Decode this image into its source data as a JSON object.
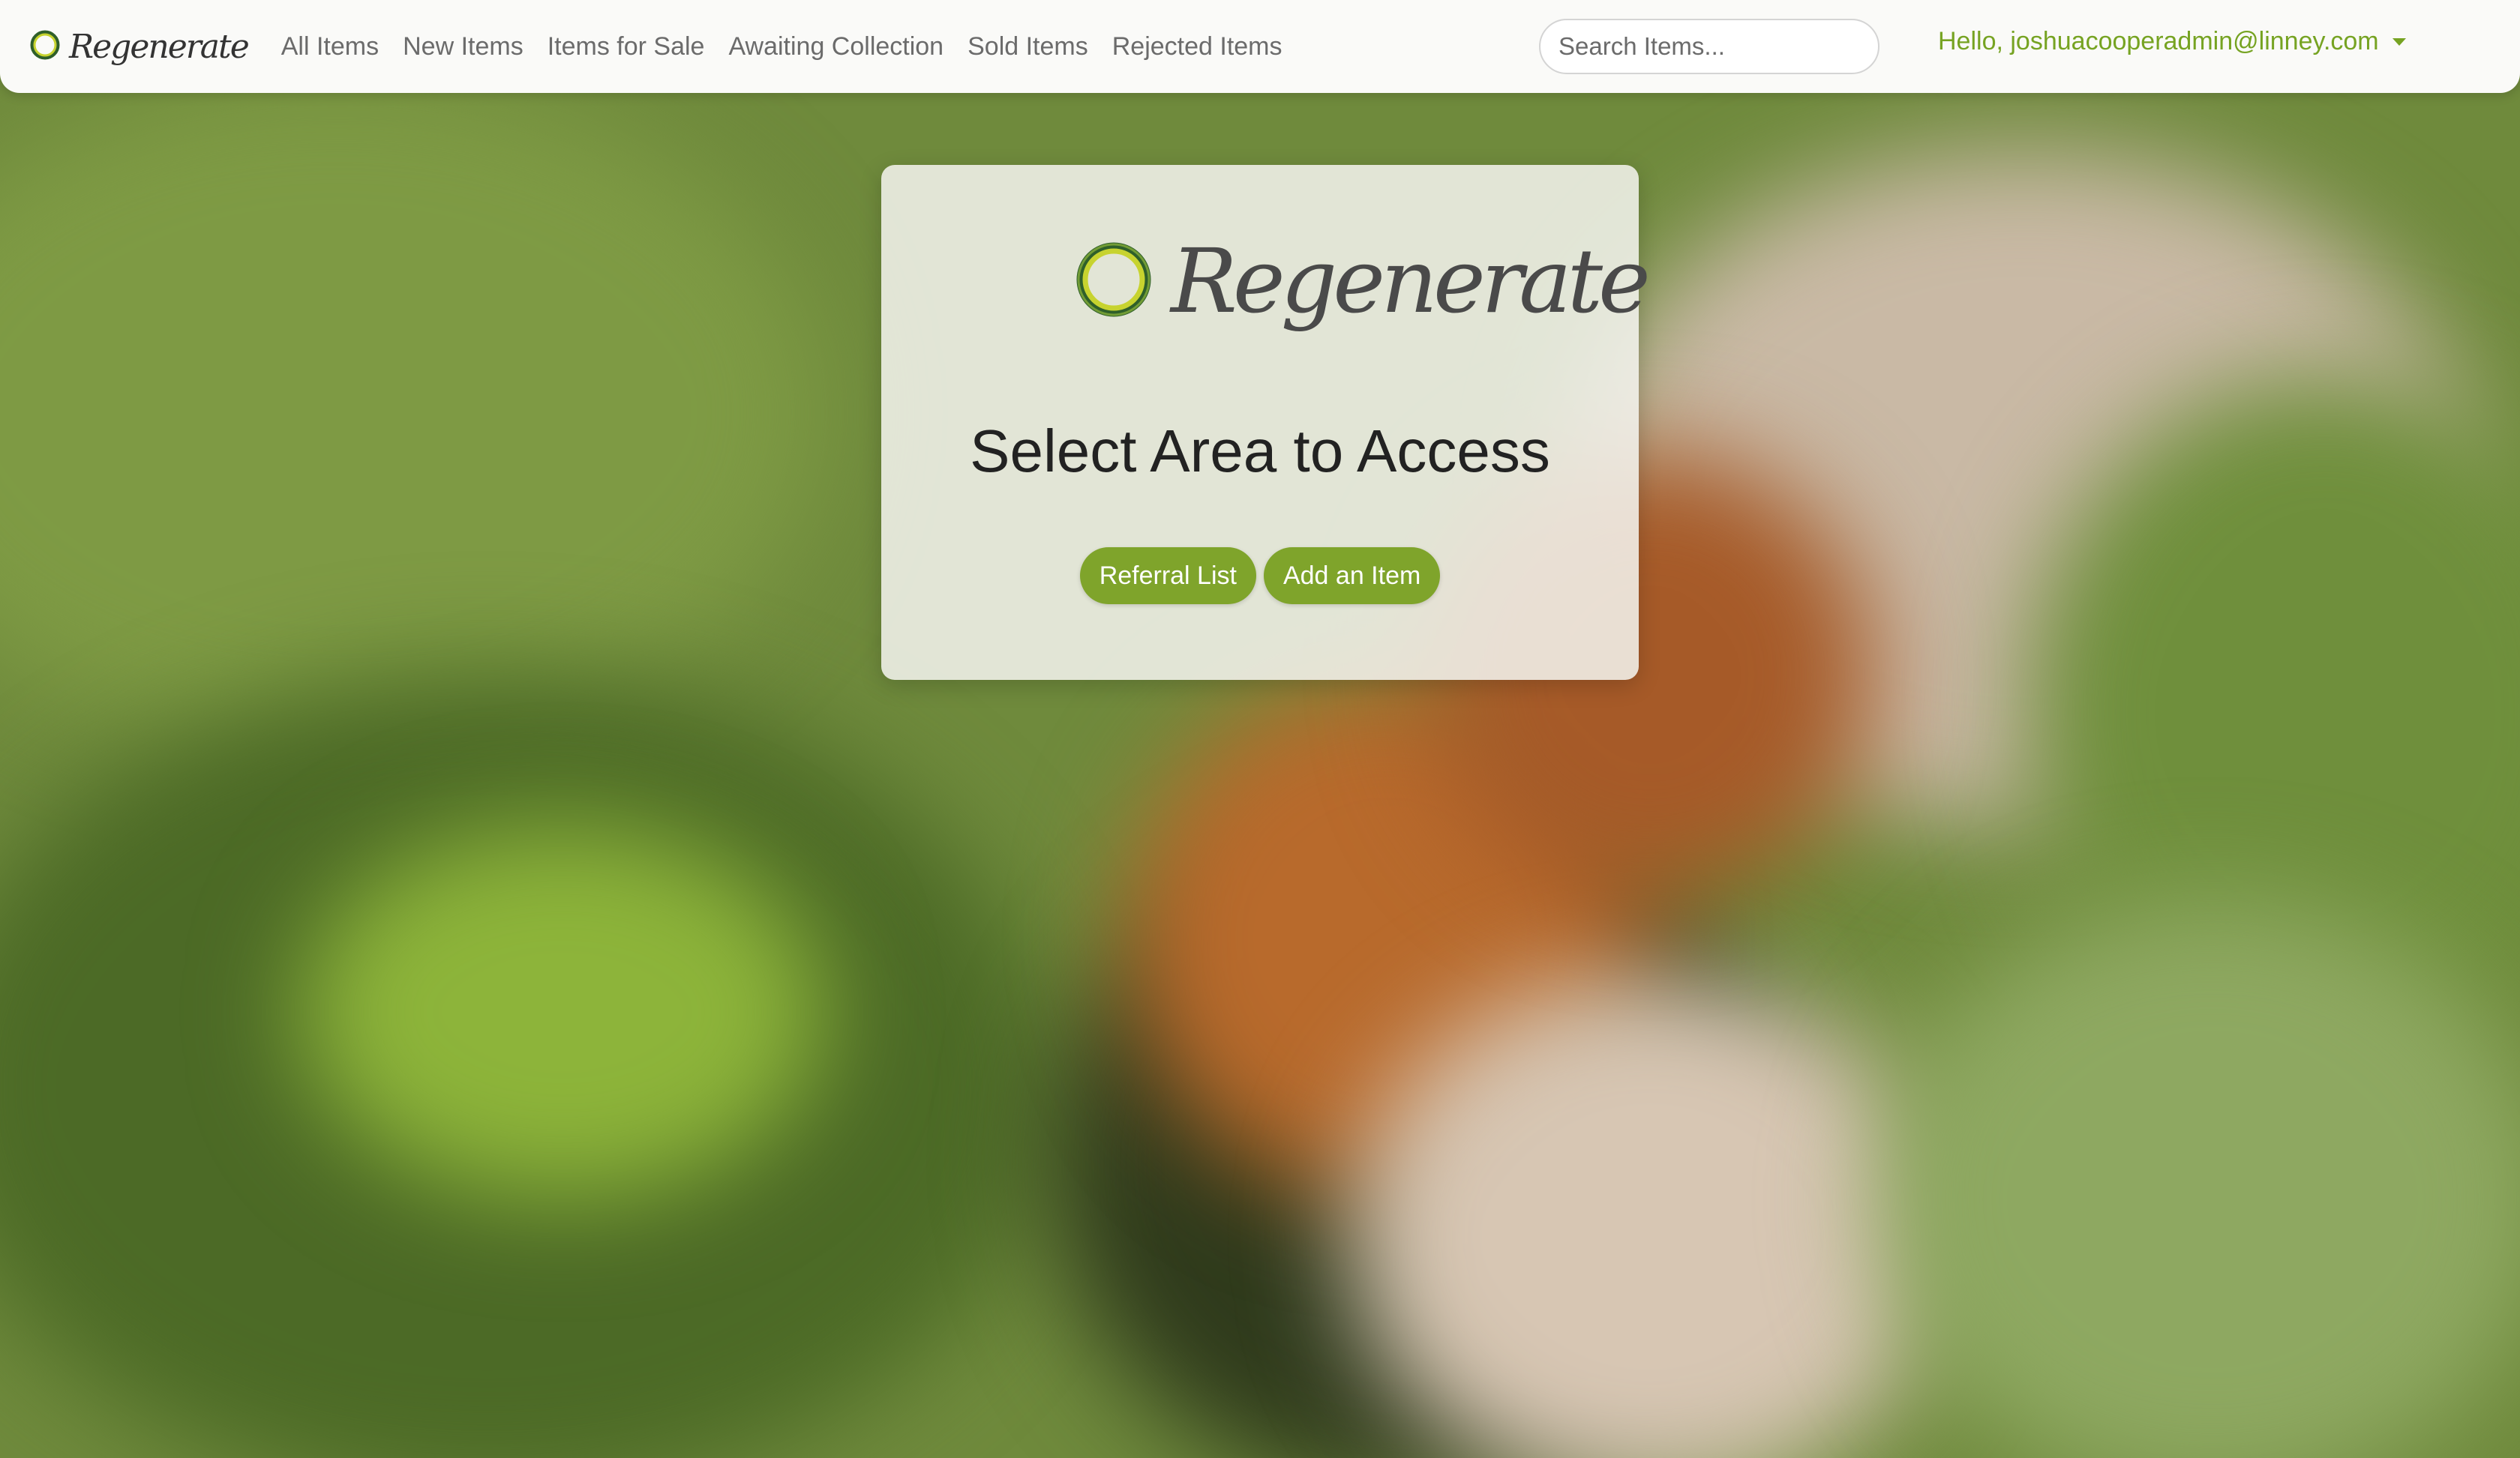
{
  "navbar": {
    "brand": "Regenerate",
    "links": [
      {
        "label": "All Items"
      },
      {
        "label": "New Items"
      },
      {
        "label": "Items for Sale"
      },
      {
        "label": "Awaiting Collection"
      },
      {
        "label": "Sold Items"
      },
      {
        "label": "Rejected Items"
      }
    ],
    "search": {
      "placeholder": "Search Items...",
      "value": ""
    },
    "user_greeting": "Hello, joshuacooperadmin@linney.com"
  },
  "card": {
    "logo_text": "Regenerate",
    "title": "Select Area to Access",
    "buttons": [
      {
        "label": "Referral List"
      },
      {
        "label": "Add an Item"
      }
    ]
  },
  "colors": {
    "accent": "#7fa42b",
    "user_link": "#76a322",
    "nav_text": "#6b6b6b"
  },
  "icons": {
    "logo": "ring-logo-icon",
    "user_dropdown": "caret-down-icon"
  }
}
